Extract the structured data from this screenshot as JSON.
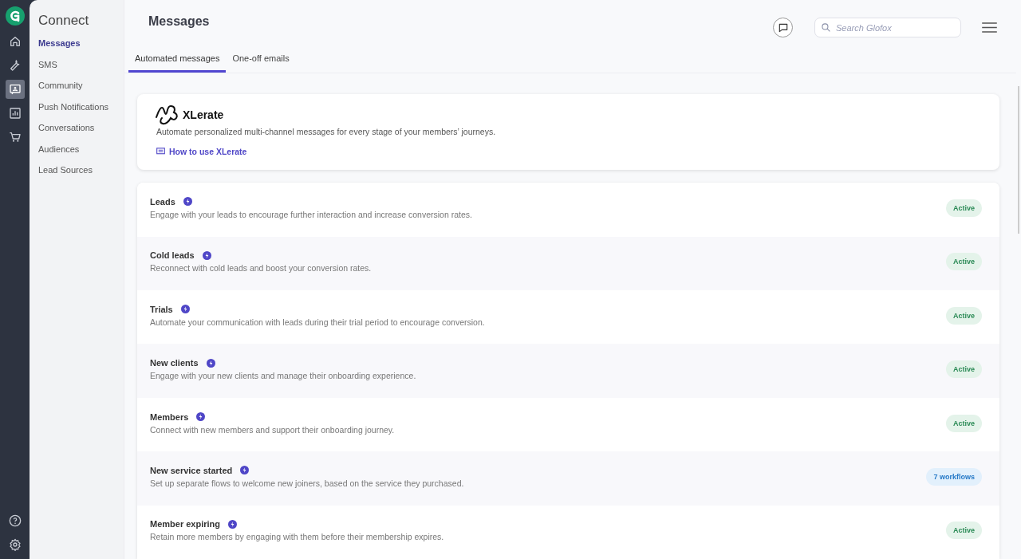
{
  "rail": [
    {
      "selected": false
    },
    {
      "selected": false
    },
    {
      "selected": true
    },
    {
      "selected": false
    },
    {
      "selected": false
    }
  ],
  "subnav": {
    "title": "Connect",
    "items": [
      {
        "label": "Messages",
        "selected": true
      },
      {
        "label": "SMS",
        "selected": false
      },
      {
        "label": "Community",
        "selected": false
      },
      {
        "label": "Push Notifications",
        "selected": false
      },
      {
        "label": "Conversations",
        "selected": false
      },
      {
        "label": "Audiences",
        "selected": false
      },
      {
        "label": "Lead Sources",
        "selected": false
      }
    ]
  },
  "header": {
    "title": "Messages",
    "search": {
      "placeholder": "Search Glofox"
    }
  },
  "tabs": [
    {
      "label": "Automated messages",
      "selected": true
    },
    {
      "label": "One-off emails",
      "selected": false
    }
  ],
  "intro": {
    "brand": "XLerate",
    "description": "Automate personalized multi-channel messages for every stage of your members’ journeys.",
    "link": "How to use XLerate"
  },
  "journeys": [
    {
      "title": "Leads",
      "description": "Engage with your leads to encourage further interaction and increase conversion rates.",
      "badge": {
        "kind": "status",
        "text": "Active"
      }
    },
    {
      "title": "Cold leads",
      "description": "Reconnect with cold leads and boost your conversion rates.",
      "badge": {
        "kind": "status",
        "text": "Active"
      }
    },
    {
      "title": "Trials",
      "description": "Automate your communication with leads during their trial period to encourage conversion.",
      "badge": {
        "kind": "status",
        "text": "Active"
      }
    },
    {
      "title": "New clients",
      "description": "Engage with your new clients and manage their onboarding experience.",
      "badge": {
        "kind": "status",
        "text": "Active"
      }
    },
    {
      "title": "Members",
      "description": "Connect with new members and support their onboarding journey.",
      "badge": {
        "kind": "status",
        "text": "Active"
      }
    },
    {
      "title": "New service started",
      "description": "Set up separate flows to welcome new joiners, based on the service they purchased.",
      "badge": {
        "kind": "count",
        "text": "7 workflows"
      }
    },
    {
      "title": "Member expiring",
      "description": "Retain more members by engaging with them before their membership expires.",
      "badge": {
        "kind": "status",
        "text": "Active"
      }
    }
  ]
}
